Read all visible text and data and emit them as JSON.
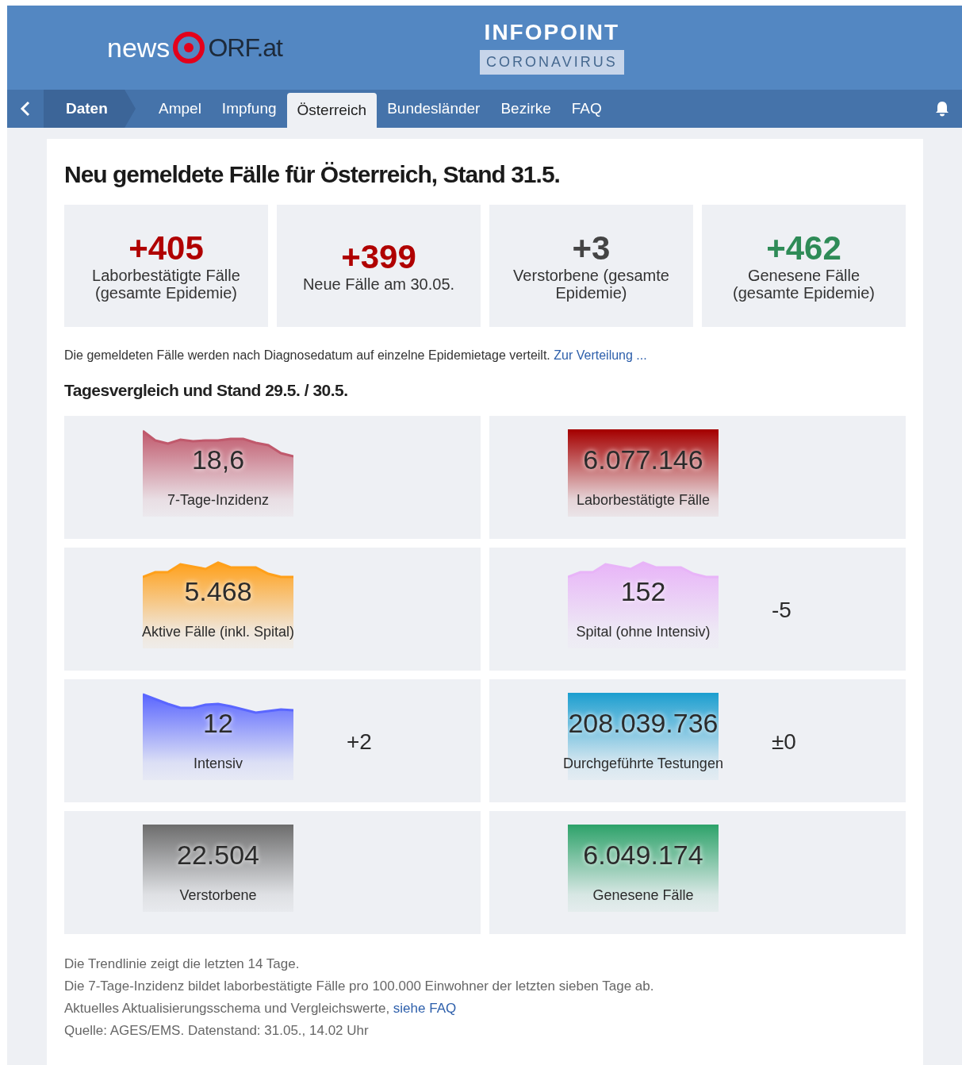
{
  "header": {
    "logo_left": "news",
    "logo_right": "ORF.at",
    "title": "INFOPOINT",
    "subtitle": "CORONAVIRUS"
  },
  "nav": {
    "section": "Daten",
    "items": [
      {
        "label": "Ampel",
        "selected": false
      },
      {
        "label": "Impfung",
        "selected": false
      },
      {
        "label": "Österreich",
        "selected": true
      },
      {
        "label": "Bundesländer",
        "selected": false
      },
      {
        "label": "Bezirke",
        "selected": false
      },
      {
        "label": "FAQ",
        "selected": false
      }
    ]
  },
  "heading": "Neu gemeldete Fälle für Österreich, Stand 31.5.",
  "summary": [
    {
      "value": "+405",
      "label": "Laborbestätigte Fälle (gesamte Epidemie)",
      "color": "#b00000"
    },
    {
      "value": "+399",
      "label": "Neue Fälle am 30.05.",
      "color": "#b00000"
    },
    {
      "value": "+3",
      "label": "Verstorbene (gesamte Epidemie)",
      "color": "#444444"
    },
    {
      "value": "+462",
      "label": "Genesene Fälle (gesamte Epidemie)",
      "color": "#2e8b57"
    }
  ],
  "note": {
    "text": "Die gemeldeten Fälle werden nach Diagnosedatum auf einzelne Epidemietage verteilt.",
    "link": "Zur Verteilung ..."
  },
  "subheading": "Tagesvergleich und Stand 29.5. / 30.5.",
  "tiles": [
    {
      "value": "18,6",
      "label": "7-Tage-Inzidenz",
      "color": "#c0596c",
      "kind": "trend"
    },
    {
      "value": "6.077.146",
      "label": "Laborbestätigte Fälle",
      "color": "#a50000",
      "kind": "flat"
    },
    {
      "value": "5.468",
      "label": "Aktive Fälle (inkl. Spital)",
      "color": "#ffa01a",
      "kind": "trend"
    },
    {
      "value": "152",
      "label": "Spital (ohne Intensiv)",
      "color": "#e8b4f8",
      "kind": "trend",
      "change": "-5"
    },
    {
      "value": "12",
      "label": "Intensiv",
      "color": "#5a66ff",
      "kind": "trend",
      "change": "+2"
    },
    {
      "value": "208.039.736",
      "label": "Durchgeführte Testungen",
      "color": "#1e9fd0",
      "kind": "flat",
      "change": "±0"
    },
    {
      "value": "22.504",
      "label": "Verstorbene",
      "color": "#6e6e6e",
      "kind": "flat"
    },
    {
      "value": "6.049.174",
      "label": "Genesene Fälle",
      "color": "#2fa36b",
      "kind": "flat"
    }
  ],
  "footnotes": [
    {
      "text": "Die Trendlinie zeigt die letzten 14 Tage."
    },
    {
      "text": "Die 7-Tage-Inzidenz bildet laborbestätigte Fälle pro 100.000 Einwohner der letzten sieben Tage ab."
    },
    {
      "text": "Aktuelles Aktualisierungsschema und Vergleichswerte,",
      "link": "siehe FAQ"
    },
    {
      "text": "Quelle: AGES/EMS. Datenstand: 31.05., 14.02 Uhr"
    }
  ]
}
